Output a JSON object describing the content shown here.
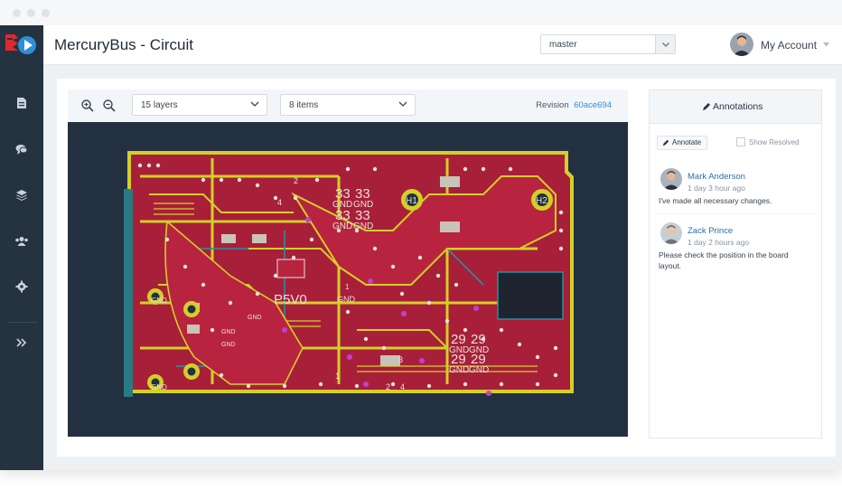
{
  "app": {
    "title": "MercuryBus - Circuit",
    "brand_color": "#e0282f",
    "accent_color": "#2d8fd8"
  },
  "header": {
    "branch_value": "master",
    "account_label": "My Account"
  },
  "sidebar": {
    "items": [
      {
        "icon": "document-icon"
      },
      {
        "icon": "chat-icon"
      },
      {
        "icon": "layers-icon"
      },
      {
        "icon": "team-icon"
      },
      {
        "icon": "gear-icon"
      },
      {
        "icon": "expand-icon"
      }
    ]
  },
  "toolbar": {
    "zoom_in_icon": "zoom-in-icon",
    "zoom_out_icon": "zoom-out-icon",
    "layers_select": "15 layers",
    "items_select": "8 items",
    "revision_label": "Revision",
    "revision_hash": "60ace694"
  },
  "pcb": {
    "labels": {
      "p5v0": "P5V0",
      "gnd": "GND",
      "n33": "33",
      "n29": "29",
      "h1": "H1",
      "h2": "H2",
      "n1": "1",
      "n2": "2",
      "n3": "3",
      "n4": "4"
    }
  },
  "annotations": {
    "title": "Annotations",
    "annotate_button": "Annotate",
    "show_resolved_label": "Show Resolved",
    "comments": [
      {
        "name": "Mark Anderson",
        "time": "1 day 3 hour ago",
        "text": "I've made all necessary changes."
      },
      {
        "name": "Zack Prince",
        "time": "1 day 2 hours ago",
        "text": "Please check the position in the board layout."
      }
    ]
  }
}
